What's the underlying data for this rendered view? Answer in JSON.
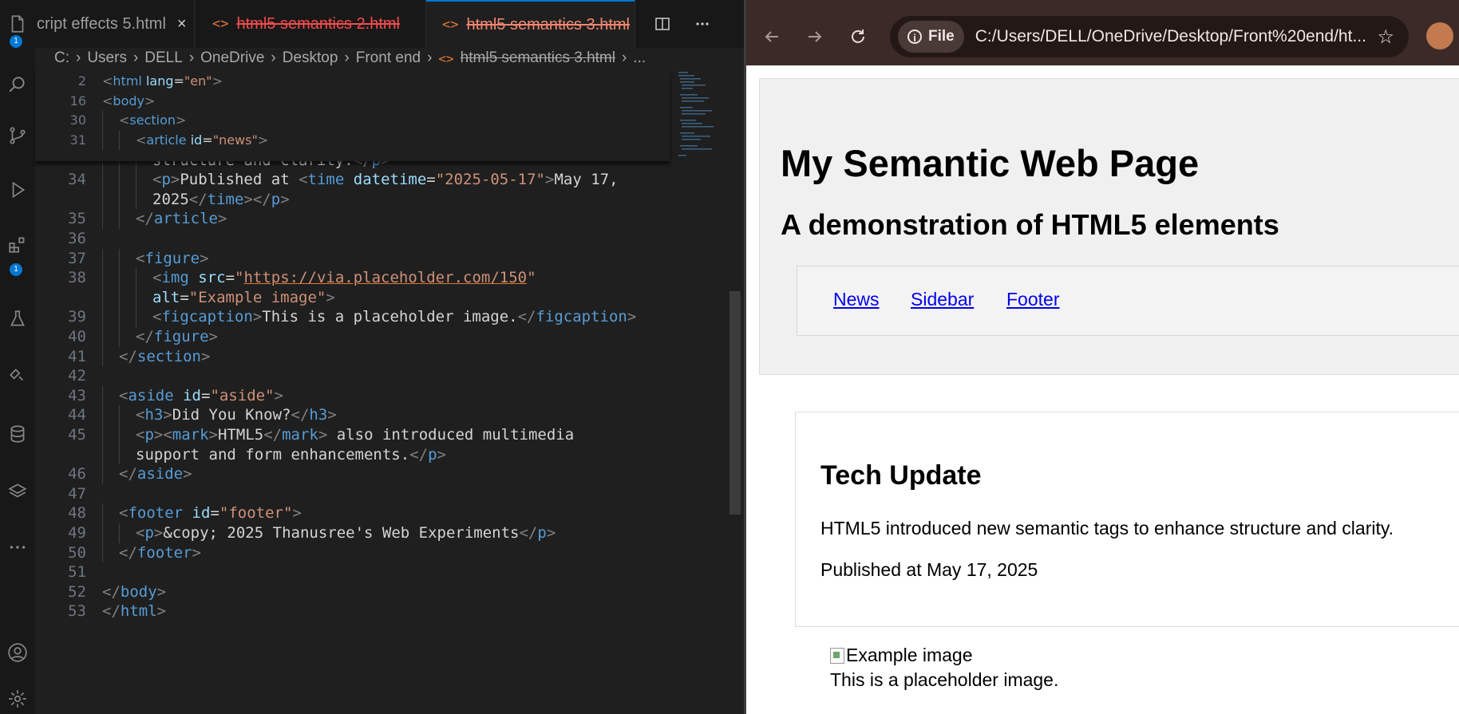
{
  "editor": {
    "tabs": [
      {
        "label": "cript effects 5.html",
        "icon": "none",
        "close": "×"
      },
      {
        "label": "html5 semantics 2.html",
        "icon": "<>"
      },
      {
        "label": "html5 semantics 3.html",
        "icon": "<>",
        "close": "×",
        "active": true
      }
    ],
    "breadcrumb": [
      "C:",
      "Users",
      "DELL",
      "OneDrive",
      "Desktop",
      "Front end",
      "html5 semantics 3.html",
      "..."
    ],
    "activity_badges": {
      "explorer": "1",
      "extensions": "1"
    },
    "sticky_lines": [
      {
        "num": "2",
        "indent": 0,
        "parts": [
          [
            "t",
            "<"
          ],
          [
            "tag",
            "html"
          ],
          [
            "tx",
            " "
          ],
          [
            "at",
            "lang"
          ],
          [
            "tx",
            "="
          ],
          [
            "st",
            "\"en\""
          ],
          [
            "t",
            ">"
          ]
        ]
      },
      {
        "num": "16",
        "indent": 0,
        "parts": [
          [
            "t",
            "<"
          ],
          [
            "tag",
            "body"
          ],
          [
            "t",
            ">"
          ]
        ]
      },
      {
        "num": "30",
        "indent": 1,
        "parts": [
          [
            "t",
            "<"
          ],
          [
            "tag",
            "section"
          ],
          [
            "t",
            ">"
          ]
        ]
      },
      {
        "num": "31",
        "indent": 2,
        "parts": [
          [
            "t",
            "<"
          ],
          [
            "tag",
            "article"
          ],
          [
            "tx",
            " "
          ],
          [
            "at",
            "id"
          ],
          [
            "tx",
            "="
          ],
          [
            "st",
            "\"news\""
          ],
          [
            "t",
            ">"
          ]
        ]
      }
    ],
    "lines": [
      {
        "num": "",
        "indent": 3,
        "parts": [
          [
            "t",
            "<"
          ],
          [
            "tag",
            "p"
          ],
          [
            "t",
            ">"
          ],
          [
            "tx",
            "HTML5 introduced new semantic tags to enhance"
          ]
        ]
      },
      {
        "num": "",
        "indent": 3,
        "parts": [
          [
            "tx",
            "structure and clarity."
          ],
          [
            "t",
            "</"
          ],
          [
            "tag",
            "p"
          ],
          [
            "t",
            ">"
          ]
        ]
      },
      {
        "num": "34",
        "indent": 3,
        "parts": [
          [
            "t",
            "<"
          ],
          [
            "tag",
            "p"
          ],
          [
            "t",
            ">"
          ],
          [
            "tx",
            "Published at "
          ],
          [
            "t",
            "<"
          ],
          [
            "tag",
            "time"
          ],
          [
            "tx",
            " "
          ],
          [
            "at",
            "datetime"
          ],
          [
            "tx",
            "="
          ],
          [
            "st",
            "\"2025-05-17\""
          ],
          [
            "t",
            ">"
          ],
          [
            "tx",
            "May 17,"
          ]
        ]
      },
      {
        "num": "",
        "indent": 3,
        "parts": [
          [
            "tx",
            "2025"
          ],
          [
            "t",
            "</"
          ],
          [
            "tag",
            "time"
          ],
          [
            "t",
            "></"
          ],
          [
            "tag",
            "p"
          ],
          [
            "t",
            ">"
          ]
        ]
      },
      {
        "num": "35",
        "indent": 2,
        "parts": [
          [
            "t",
            "</"
          ],
          [
            "tag",
            "article"
          ],
          [
            "t",
            ">"
          ]
        ]
      },
      {
        "num": "36",
        "indent": 0,
        "parts": []
      },
      {
        "num": "37",
        "indent": 2,
        "parts": [
          [
            "t",
            "<"
          ],
          [
            "tag",
            "figure"
          ],
          [
            "t",
            ">"
          ]
        ]
      },
      {
        "num": "38",
        "indent": 3,
        "parts": [
          [
            "t",
            "<"
          ],
          [
            "tag",
            "img"
          ],
          [
            "tx",
            " "
          ],
          [
            "at",
            "src"
          ],
          [
            "tx",
            "="
          ],
          [
            "st",
            "\""
          ],
          [
            "stu",
            "https://via.placeholder.com/150"
          ],
          [
            "st",
            "\""
          ]
        ]
      },
      {
        "num": "",
        "indent": 3,
        "parts": [
          [
            "at",
            "alt"
          ],
          [
            "tx",
            "="
          ],
          [
            "st",
            "\"Example image\""
          ],
          [
            "t",
            ">"
          ]
        ]
      },
      {
        "num": "39",
        "indent": 3,
        "parts": [
          [
            "t",
            "<"
          ],
          [
            "tag",
            "figcaption"
          ],
          [
            "t",
            ">"
          ],
          [
            "tx",
            "This is a placeholder image."
          ],
          [
            "t",
            "</"
          ],
          [
            "tag",
            "figcaption"
          ],
          [
            "t",
            ">"
          ]
        ]
      },
      {
        "num": "40",
        "indent": 2,
        "parts": [
          [
            "t",
            "</"
          ],
          [
            "tag",
            "figure"
          ],
          [
            "t",
            ">"
          ]
        ]
      },
      {
        "num": "41",
        "indent": 1,
        "parts": [
          [
            "t",
            "</"
          ],
          [
            "tag",
            "section"
          ],
          [
            "t",
            ">"
          ]
        ]
      },
      {
        "num": "42",
        "indent": 0,
        "parts": []
      },
      {
        "num": "43",
        "indent": 1,
        "parts": [
          [
            "t",
            "<"
          ],
          [
            "tag",
            "aside"
          ],
          [
            "tx",
            " "
          ],
          [
            "at",
            "id"
          ],
          [
            "tx",
            "="
          ],
          [
            "st",
            "\"aside\""
          ],
          [
            "t",
            ">"
          ]
        ]
      },
      {
        "num": "44",
        "indent": 2,
        "parts": [
          [
            "t",
            "<"
          ],
          [
            "tag",
            "h3"
          ],
          [
            "t",
            ">"
          ],
          [
            "tx",
            "Did You Know?"
          ],
          [
            "t",
            "</"
          ],
          [
            "tag",
            "h3"
          ],
          [
            "t",
            ">"
          ]
        ]
      },
      {
        "num": "45",
        "indent": 2,
        "parts": [
          [
            "t",
            "<"
          ],
          [
            "tag",
            "p"
          ],
          [
            "t",
            "><"
          ],
          [
            "tag",
            "mark"
          ],
          [
            "t",
            ">"
          ],
          [
            "tx",
            "HTML5"
          ],
          [
            "t",
            "</"
          ],
          [
            "tag",
            "mark"
          ],
          [
            "t",
            ">"
          ],
          [
            "tx",
            " also introduced multimedia"
          ]
        ]
      },
      {
        "num": "",
        "indent": 2,
        "parts": [
          [
            "tx",
            "support and form enhancements."
          ],
          [
            "t",
            "</"
          ],
          [
            "tag",
            "p"
          ],
          [
            "t",
            ">"
          ]
        ]
      },
      {
        "num": "46",
        "indent": 1,
        "parts": [
          [
            "t",
            "</"
          ],
          [
            "tag",
            "aside"
          ],
          [
            "t",
            ">"
          ]
        ]
      },
      {
        "num": "47",
        "indent": 0,
        "parts": []
      },
      {
        "num": "48",
        "indent": 1,
        "parts": [
          [
            "t",
            "<"
          ],
          [
            "tag",
            "footer"
          ],
          [
            "tx",
            " "
          ],
          [
            "at",
            "id"
          ],
          [
            "tx",
            "="
          ],
          [
            "st",
            "\"footer\""
          ],
          [
            "t",
            ">"
          ]
        ]
      },
      {
        "num": "49",
        "indent": 2,
        "parts": [
          [
            "t",
            "<"
          ],
          [
            "tag",
            "p"
          ],
          [
            "t",
            ">"
          ],
          [
            "tx",
            "&copy; 2025 Thanusree's Web Experiments"
          ],
          [
            "t",
            "</"
          ],
          [
            "tag",
            "p"
          ],
          [
            "t",
            ">"
          ]
        ]
      },
      {
        "num": "50",
        "indent": 1,
        "parts": [
          [
            "t",
            "</"
          ],
          [
            "tag",
            "footer"
          ],
          [
            "t",
            ">"
          ]
        ]
      },
      {
        "num": "51",
        "indent": 0,
        "parts": []
      },
      {
        "num": "52",
        "indent": 0,
        "parts": [
          [
            "t",
            "</"
          ],
          [
            "tag",
            "body"
          ],
          [
            "t",
            ">"
          ]
        ]
      },
      {
        "num": "53",
        "indent": 0,
        "parts": [
          [
            "t",
            "</"
          ],
          [
            "tag",
            "html"
          ],
          [
            "t",
            ">"
          ]
        ]
      }
    ]
  },
  "browser": {
    "chip_label": "File",
    "url": "C:/Users/DELL/OneDrive/Desktop/Front%20end/ht...",
    "page": {
      "h1": "My Semantic Web Page",
      "h2": "A demonstration of HTML5 elements",
      "nav": [
        "News",
        "Sidebar",
        "Footer"
      ],
      "article_title": "Tech Update",
      "article_p1": "HTML5 introduced new semantic tags to enhance structure and clarity.",
      "article_p2": "Published at May 17, 2025",
      "figure_alt": "Example image",
      "figcaption": "This is a placeholder image."
    }
  },
  "colors": {
    "accent": "#0078d4",
    "tag": "#569cd6",
    "attribute": "#9cdcfe",
    "string": "#ce9178",
    "browser_frame": "#3c2a28",
    "link": "#0000ee"
  }
}
